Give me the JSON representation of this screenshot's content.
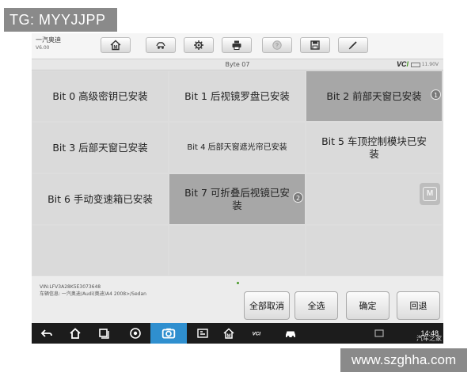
{
  "watermarks": {
    "top": "TG: MYYJJPP",
    "bottom": "www.szghha.com",
    "corner": "汽车之家"
  },
  "app": {
    "brand": "一汽奥迪",
    "version": "V6.00"
  },
  "toolbar": {
    "buttons": [
      {
        "icon": "home-icon"
      },
      {
        "icon": "car-lift-icon"
      },
      {
        "icon": "gear-icon"
      },
      {
        "icon": "printer-icon"
      },
      {
        "icon": "help-icon"
      },
      {
        "icon": "save-icon"
      },
      {
        "icon": "pen-icon"
      }
    ]
  },
  "status": {
    "title": "Byte 07",
    "vci": "VC",
    "vci_suffix": "I",
    "battery": "11.90V"
  },
  "bits": [
    {
      "label": "Bit 0 高级密钥已安装",
      "selected": false
    },
    {
      "label": "Bit 1 后视镜罗盘已安装",
      "selected": false
    },
    {
      "label": "Bit 2 前部天窗已安装",
      "selected": true,
      "badge": "1"
    },
    {
      "label": "Bit 3 后部天窗已安装",
      "selected": false
    },
    {
      "label": "Bit 4 后部天窗遮光帘已安装",
      "selected": false
    },
    {
      "label": "Bit 5 车顶控制模块已安装",
      "selected": false
    },
    {
      "label": "Bit 6 手动变速箱已安装",
      "selected": false
    },
    {
      "label": "Bit 7 可折叠后视镜已安装",
      "selected": true,
      "badge": "2"
    }
  ],
  "side_icon": {
    "icon": "m-icon",
    "letter": "M"
  },
  "vehicle": {
    "vin": "VIN:LFV3A28K5E3073648",
    "info": "车辆信息: 一汽奥迪/Audi(奥迪)A4 2008>/Sedan"
  },
  "actions": {
    "deselect_all": "全部取消",
    "select_all": "全选",
    "confirm": "确定",
    "back": "回退"
  },
  "system": {
    "time": "14:48"
  }
}
